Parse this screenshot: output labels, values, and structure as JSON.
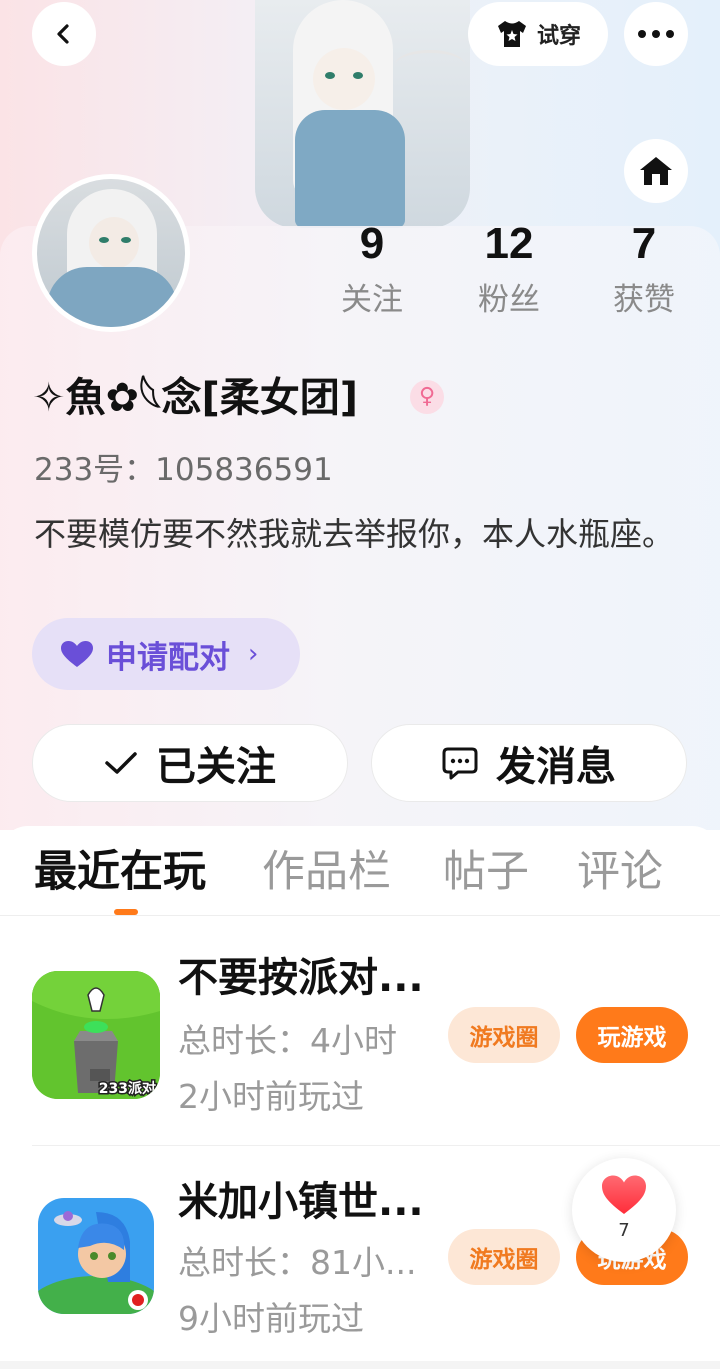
{
  "header": {
    "back_icon": "chevron-left-icon",
    "try_on_label": "试穿",
    "try_on_icon": "shirt-icon",
    "more_icon": "more-dots-icon",
    "home_icon": "home-icon"
  },
  "profile": {
    "nickname": "✧魚✿𓆩念[柔女团]",
    "gender_symbol": "♀",
    "id_text": "233号：105836591",
    "bio": "不要模仿要不然我就去举报你，本人水瓶座。",
    "stats": [
      {
        "value": "9",
        "label": "关注"
      },
      {
        "value": "12",
        "label": "粉丝"
      },
      {
        "value": "7",
        "label": "获赞"
      }
    ]
  },
  "pair_button": {
    "label": "申请配对",
    "icon": "heart-icon"
  },
  "actions": {
    "follow_label": "已关注",
    "message_label": "发消息"
  },
  "tabs": [
    "最近在玩",
    "作品栏",
    "帖子",
    "评论"
  ],
  "active_tab_index": 0,
  "games": [
    {
      "title": "不要按派对...",
      "duration": "总时长：4小时",
      "last_played": "2小时前玩过",
      "icon_text": "233派对",
      "circle_label": "游戏圈",
      "play_label": "玩游戏"
    },
    {
      "title": "米加小镇世...",
      "duration": "总时长：81小...",
      "last_played": "9小时前玩过",
      "circle_label": "游戏圈",
      "play_label": "玩游戏"
    }
  ],
  "like_float": {
    "count": "7"
  },
  "colors": {
    "accent": "#ff7a1a",
    "pair_purple": "#6a4fd8",
    "gender_pink": "#f06a93"
  }
}
